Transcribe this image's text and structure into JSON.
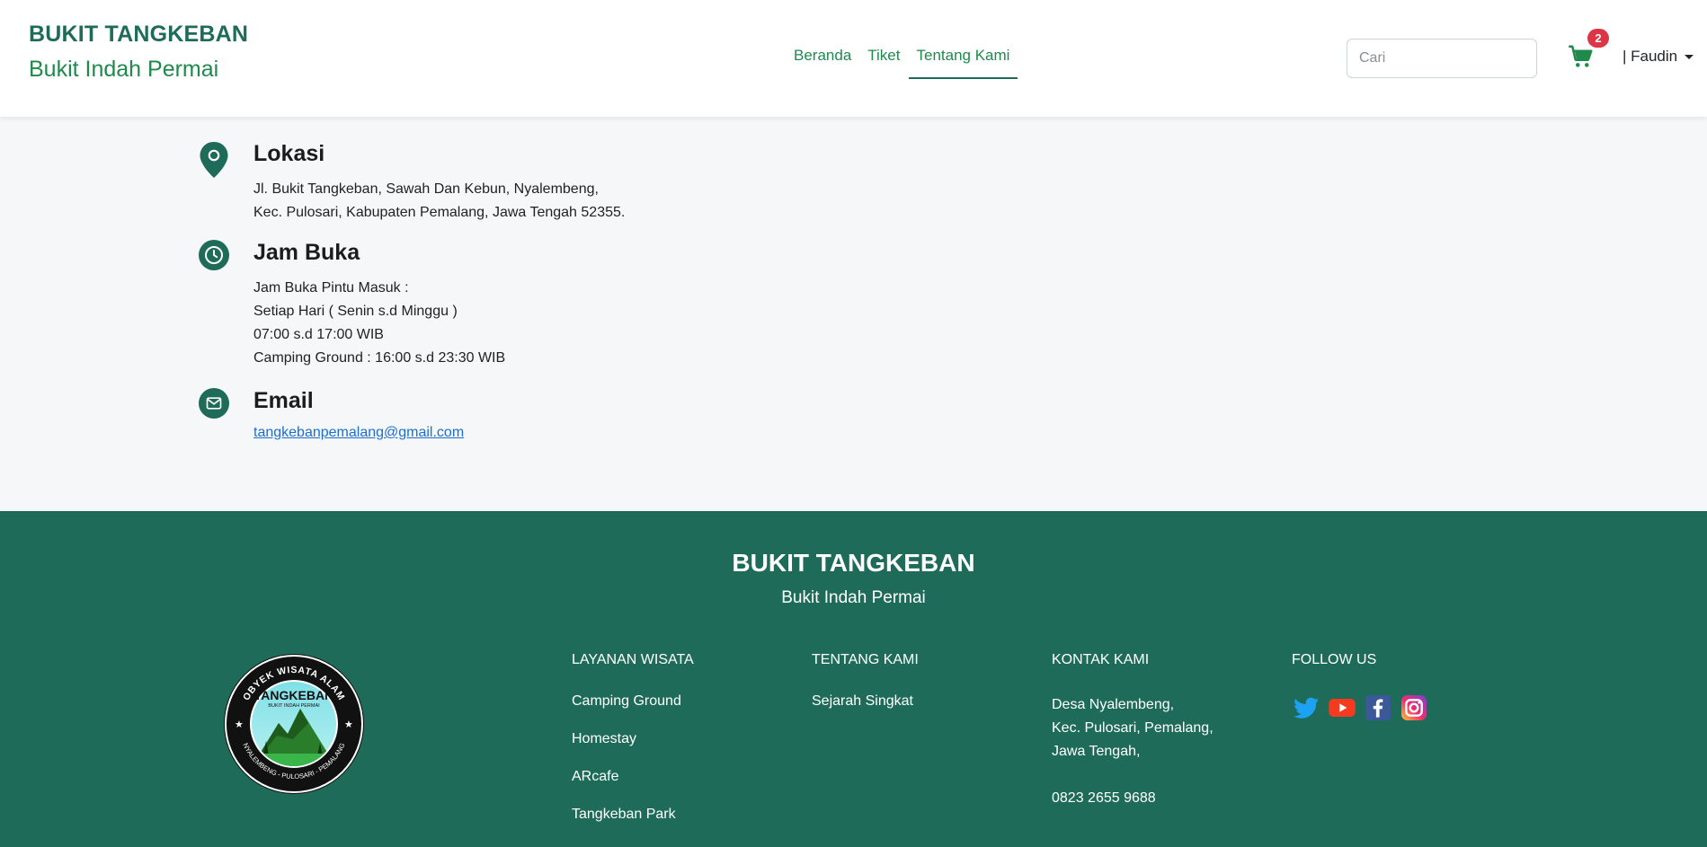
{
  "header": {
    "brand_title": "BUKIT TANGKEBAN",
    "brand_subtitle": "Bukit Indah Permai",
    "nav": [
      {
        "label": "Beranda"
      },
      {
        "label": "Tiket"
      },
      {
        "label": "Tentang Kami",
        "active": true
      }
    ],
    "search_placeholder": "Cari",
    "cart_count": "2",
    "user_label": "| Faudin",
    "accent_color": "#1e6b59",
    "link_color": "#1f8a4c"
  },
  "info": {
    "location": {
      "icon": "map-pin-icon",
      "title": "Lokasi",
      "lines": [
        "Jl. Bukit Tangkeban, Sawah Dan Kebun, Nyalembeng,",
        "Kec. Pulosari, Kabupaten Pemalang, Jawa Tengah 52355."
      ]
    },
    "hours": {
      "icon": "clock-icon",
      "title": "Jam Buka",
      "lines": [
        "Jam Buka Pintu Masuk :",
        "Setiap Hari ( Senin s.d Minggu )",
        "07:00 s.d 17:00 WIB",
        "Camping Ground : 16:00 s.d 23:30 WIB"
      ]
    },
    "email": {
      "icon": "envelope-icon",
      "title": "Email",
      "address": "tangkebanpemalang@gmail.com"
    }
  },
  "footer": {
    "title": "BUKIT TANGKEBAN",
    "subtitle": "Bukit Indah Permai",
    "logo": {
      "top_text": "OBYEK WISATA ALAM",
      "name": "TANGKEBAN",
      "name_sub": "BUKIT INDAH PERMAI",
      "bottom_text": "NYALEMBENG - PULOSARI - PEMALANG"
    },
    "layanan": {
      "heading": "LAYANAN WISATA",
      "items": [
        "Camping Ground",
        "Homestay",
        "ARcafe",
        "Tangkeban Park"
      ]
    },
    "tentang": {
      "heading": "TENTANG KAMI",
      "items": [
        "Sejarah Singkat"
      ]
    },
    "kontak": {
      "heading": "KONTAK KAMI",
      "address_lines": [
        "Desa Nyalembeng,",
        "Kec. Pulosari, Pemalang,",
        "Jawa Tengah,"
      ],
      "phone": "0823 2655 9688"
    },
    "follow": {
      "heading": "FOLLOW US",
      "icons": [
        "twitter-icon",
        "youtube-icon",
        "facebook-icon",
        "instagram-icon"
      ]
    },
    "background": "#1e6b59"
  }
}
